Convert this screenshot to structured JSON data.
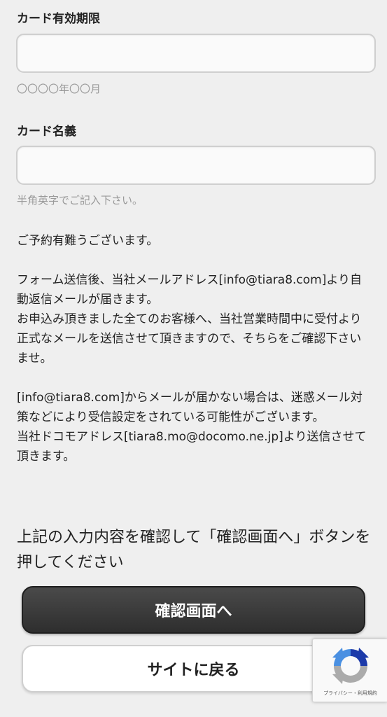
{
  "form": {
    "expiry": {
      "label": "カード有効期限",
      "value": "",
      "placeholder": "",
      "hint": "〇〇〇〇年〇〇月"
    },
    "holder": {
      "label": "カード名義",
      "value": "",
      "placeholder": "",
      "hint": "半角英字でご記入下さい。"
    }
  },
  "message": {
    "thanks": "ご予約有難うございます。",
    "para1_line1": "フォーム送信後、当社メールアドレス[info@tiara8.com]より自動返信メールが届きます。",
    "para1_line2": "お申込み頂きました全てのお客様へ、当社営業時間中に受付より正式なメールを送信させて頂きますので、そちらをご確認下さいませ。",
    "para2_line1": "[info@tiara8.com]からメールが届かない場合は、迷惑メール対策などにより受信設定をされている可能性がございます。",
    "para2_line2": "当社ドコモアドレス[tiara8.mo@docomo.ne.jp]より送信させて頂きます。"
  },
  "instruction": "上記の入力内容を確認して「確認画面へ」ボタンを押してください",
  "buttons": {
    "confirm_label": "確認画面へ",
    "back_label": "サイトに戻る"
  },
  "recaptcha": {
    "links": "プライバシー・利用規約",
    "colors": {
      "blue": "#1c3aa9",
      "lightblue": "#4a90e2",
      "gray": "#ababab"
    }
  }
}
